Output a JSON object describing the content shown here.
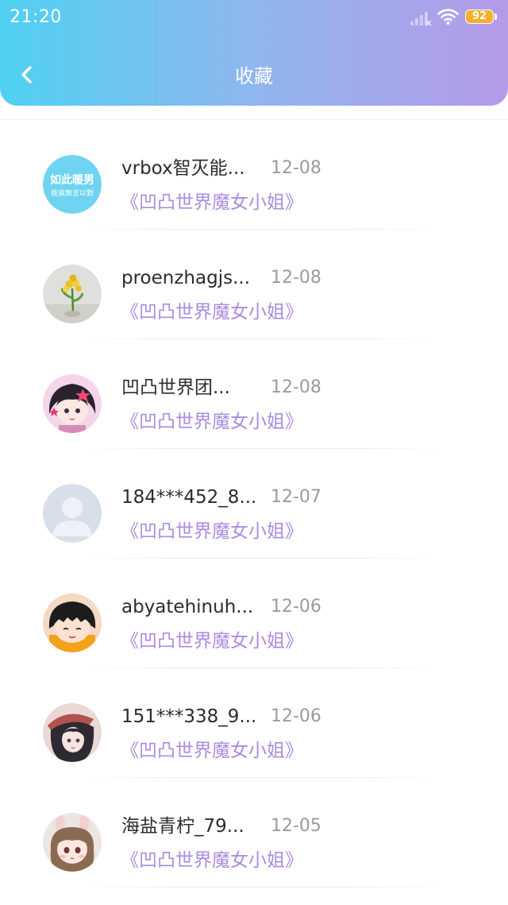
{
  "status_bar": {
    "time": "21:20",
    "battery": "92"
  },
  "header": {
    "title": "收藏"
  },
  "favorites": [
    {
      "name": "vrbox智灭能...",
      "date": "12-08",
      "title": "《凹凸世界魔女小姐》",
      "avatar": "avatar-text-logo",
      "avatar_text_top": "如此暖男",
      "avatar_text_bottom": "我竟無言以對"
    },
    {
      "name": "proenzhagjs...",
      "date": "12-08",
      "title": "《凹凸世界魔女小姐》",
      "avatar": "avatar-flower"
    },
    {
      "name": "凹凸世界团...",
      "date": "12-08",
      "title": "《凹凸世界魔女小姐》",
      "avatar": "avatar-anime-girl"
    },
    {
      "name": "184***452_8...",
      "date": "12-07",
      "title": "《凹凸世界魔女小姐》",
      "avatar": "avatar-default-user"
    },
    {
      "name": "abyatehinuh...",
      "date": "12-06",
      "title": "《凹凸世界魔女小姐》",
      "avatar": "avatar-cartoon-girl"
    },
    {
      "name": "151***338_9...",
      "date": "12-06",
      "title": "《凹凸世界魔女小姐》",
      "avatar": "avatar-anime-hat"
    },
    {
      "name": "海盐青柠_79...",
      "date": "12-05",
      "title": "《凹凸世界魔女小姐》",
      "avatar": "avatar-anime-bunny"
    }
  ],
  "colors": {
    "header_gradient_start": "#4fd1f1",
    "header_gradient_end": "#b59ae9",
    "title_accent": "#ac8be0",
    "battery": "#f6b02a"
  }
}
